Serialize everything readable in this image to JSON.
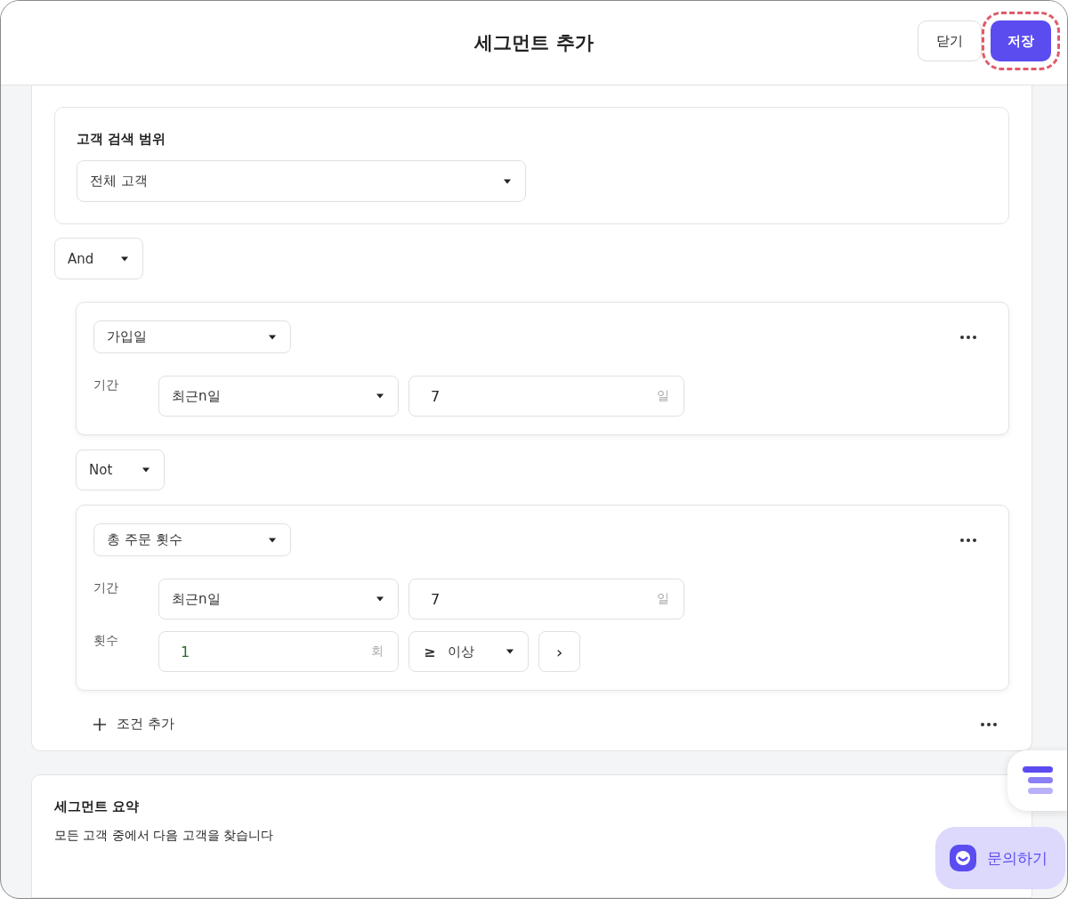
{
  "header": {
    "title": "세그먼트 추가",
    "buttons": [
      {
        "label": "닫기",
        "kind": "secondary",
        "highlighted": false
      },
      {
        "label": "저장",
        "kind": "primary",
        "highlighted": true
      }
    ]
  },
  "scope": {
    "title": "고객 검색 범위",
    "select": "전체 고객"
  },
  "operator": "And",
  "conditions": [
    {
      "field": "가입일",
      "rows": [
        {
          "kind": "period",
          "label": "기간",
          "select": "최근n일",
          "value": "7",
          "unit": "일"
        }
      ]
    },
    {
      "join": "Not",
      "field": "총 주문 횟수",
      "rows": [
        {
          "kind": "period",
          "label": "기간",
          "select": "최근n일",
          "value": "7",
          "unit": "일"
        },
        {
          "kind": "count",
          "label": "횟수",
          "value": "1",
          "unit": "회",
          "symbol": "≥",
          "comparator": "이상",
          "next": "›"
        }
      ]
    }
  ],
  "add_condition": {
    "label": "조건 추가"
  },
  "summary": {
    "title": "세그먼트 요약",
    "text": "모든 고객 중에서 다음 고객을 찾습니다"
  },
  "chat_button": {
    "label": "문의하기"
  }
}
